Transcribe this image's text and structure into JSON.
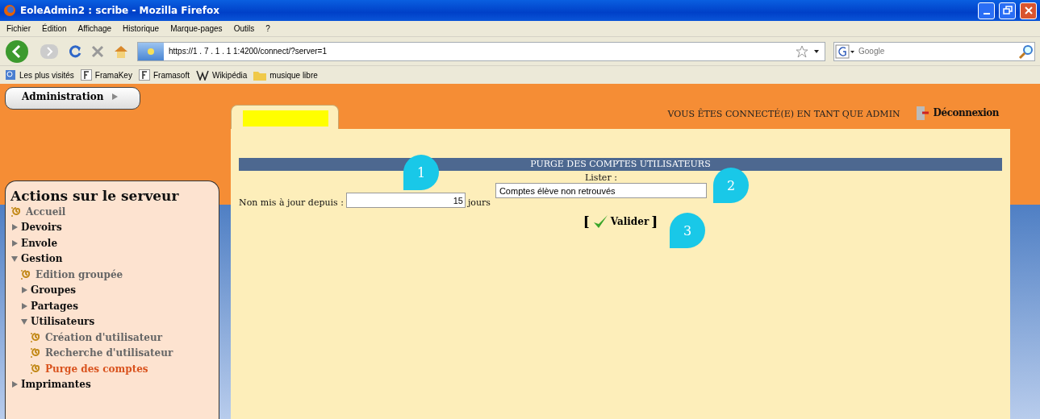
{
  "window": {
    "title": "EoleAdmin2 : scribe - Mozilla Firefox"
  },
  "menu": [
    "Fichier",
    "Édition",
    "Affichage",
    "Historique",
    "Marque-pages",
    "Outils",
    "?"
  ],
  "address": {
    "value": "https://1 . 7 . 1 . 1 1:4200/connect/?server=1"
  },
  "search": {
    "placeholder": "Google"
  },
  "bookmarks": [
    {
      "label": "Les plus visités",
      "kind": "smart"
    },
    {
      "label": "FramaKey",
      "kind": "f"
    },
    {
      "label": "Framasoft",
      "kind": "f"
    },
    {
      "label": "Wikipédia",
      "kind": "w"
    },
    {
      "label": "musique libre",
      "kind": "folder"
    }
  ],
  "admin_menu": {
    "label": "Administration"
  },
  "header": {
    "status": "VOUS ÊTES CONNECTÉ(E) EN TANT QUE ADMIN",
    "logout": "Déconnexion"
  },
  "sidebar": {
    "title": "Actions sur le serveur",
    "items": [
      {
        "label": "Accueil",
        "kind": "link",
        "selected": false
      },
      {
        "label": "Devoirs",
        "kind": "folder",
        "expanded": false
      },
      {
        "label": "Envole",
        "kind": "folder",
        "expanded": false
      },
      {
        "label": "Gestion",
        "kind": "folder",
        "expanded": true,
        "children": [
          {
            "label": "Edition groupée",
            "kind": "link",
            "selected": false
          },
          {
            "label": "Groupes",
            "kind": "folder",
            "expanded": false
          },
          {
            "label": "Partages",
            "kind": "folder",
            "expanded": false
          },
          {
            "label": "Utilisateurs",
            "kind": "folder",
            "expanded": true,
            "children": [
              {
                "label": "Création d'utilisateur",
                "kind": "link",
                "selected": false
              },
              {
                "label": "Recherche d'utilisateur",
                "kind": "link",
                "selected": false
              },
              {
                "label": "Purge des comptes",
                "kind": "link",
                "selected": true
              }
            ]
          }
        ]
      },
      {
        "label": "Imprimantes",
        "kind": "folder",
        "expanded": false
      }
    ]
  },
  "form": {
    "title": "PURGE DES COMPTES UTILISATEURS",
    "list_label": "Lister :",
    "list_value": "Comptes élève non retrouvés",
    "age_label": "Non mis à jour depuis :",
    "age_value": "15",
    "age_unit": "jours",
    "submit": "Valider",
    "submit_open": "[",
    "submit_close": "]"
  },
  "callouts": [
    "1",
    "2",
    "3"
  ]
}
